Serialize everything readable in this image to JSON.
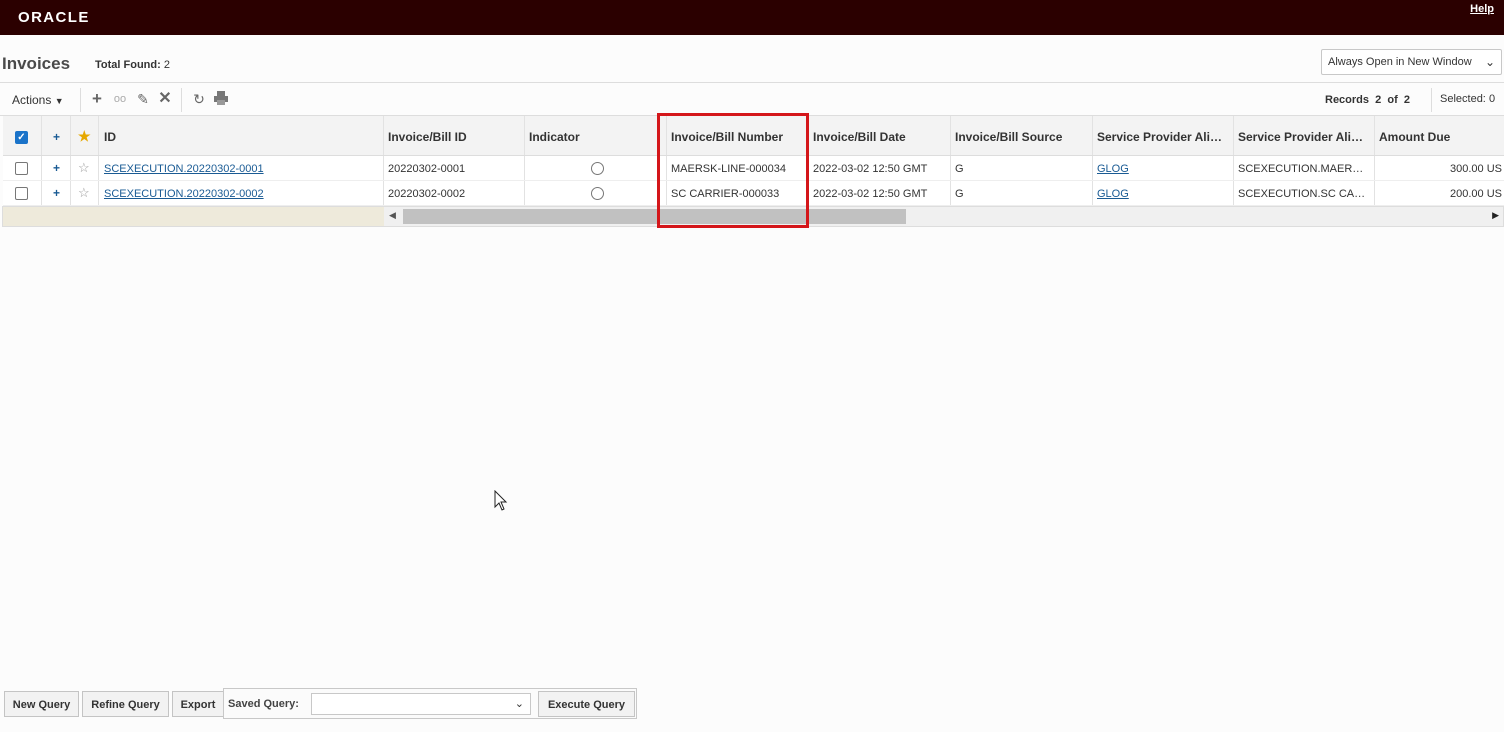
{
  "app": {
    "brand": "ORACLE",
    "help_label": "Help"
  },
  "header": {
    "title": "Invoices",
    "total_found_label": "Total Found:",
    "total_found_value": "2",
    "window_mode": "Always Open in New Window"
  },
  "toolbar": {
    "actions_label": "Actions",
    "records_label": "Records",
    "records_current": "2",
    "records_of": "of",
    "records_total": "2",
    "selected_label": "Selected:",
    "selected_value": "0",
    "icons": [
      "add-icon",
      "view-icon",
      "edit-icon",
      "delete-icon",
      "refresh-icon",
      "print-icon"
    ]
  },
  "table": {
    "columns": [
      "ID",
      "Invoice/Bill ID",
      "Indicator",
      "Invoice/Bill Number",
      "Invoice/Bill Date",
      "Invoice/Bill Source",
      "Service Provider Ali…",
      "Service Provider Ali…",
      "Amount Due"
    ],
    "rows": [
      {
        "id": "SCEXECUTION.20220302-0001",
        "invoice_bill_id": "20220302-0001",
        "invoice_bill_number": "MAERSK-LINE-000034",
        "invoice_bill_date": "2022-03-02 12:50 GMT",
        "invoice_bill_source": "G",
        "service_provider_alias": "GLOG",
        "service_provider_alias2": "SCEXECUTION.MAER…",
        "amount_due": "300.00 US"
      },
      {
        "id": "SCEXECUTION.20220302-0002",
        "invoice_bill_id": "20220302-0002",
        "invoice_bill_number": "SC CARRIER-000033",
        "invoice_bill_date": "2022-03-02 12:50 GMT",
        "invoice_bill_source": "G",
        "service_provider_alias": "GLOG",
        "service_provider_alias2": "SCEXECUTION.SC CA…",
        "amount_due": "200.00 US"
      }
    ]
  },
  "footer": {
    "new_query": "New Query",
    "refine_query": "Refine Query",
    "export": "Export",
    "saved_query_label": "Saved Query:",
    "saved_query_value": "",
    "execute_query": "Execute Query"
  },
  "colors": {
    "topbar": "#2b0000",
    "link": "#1a5b94",
    "highlight": "#d4161a",
    "checkbox": "#1a73c9"
  }
}
